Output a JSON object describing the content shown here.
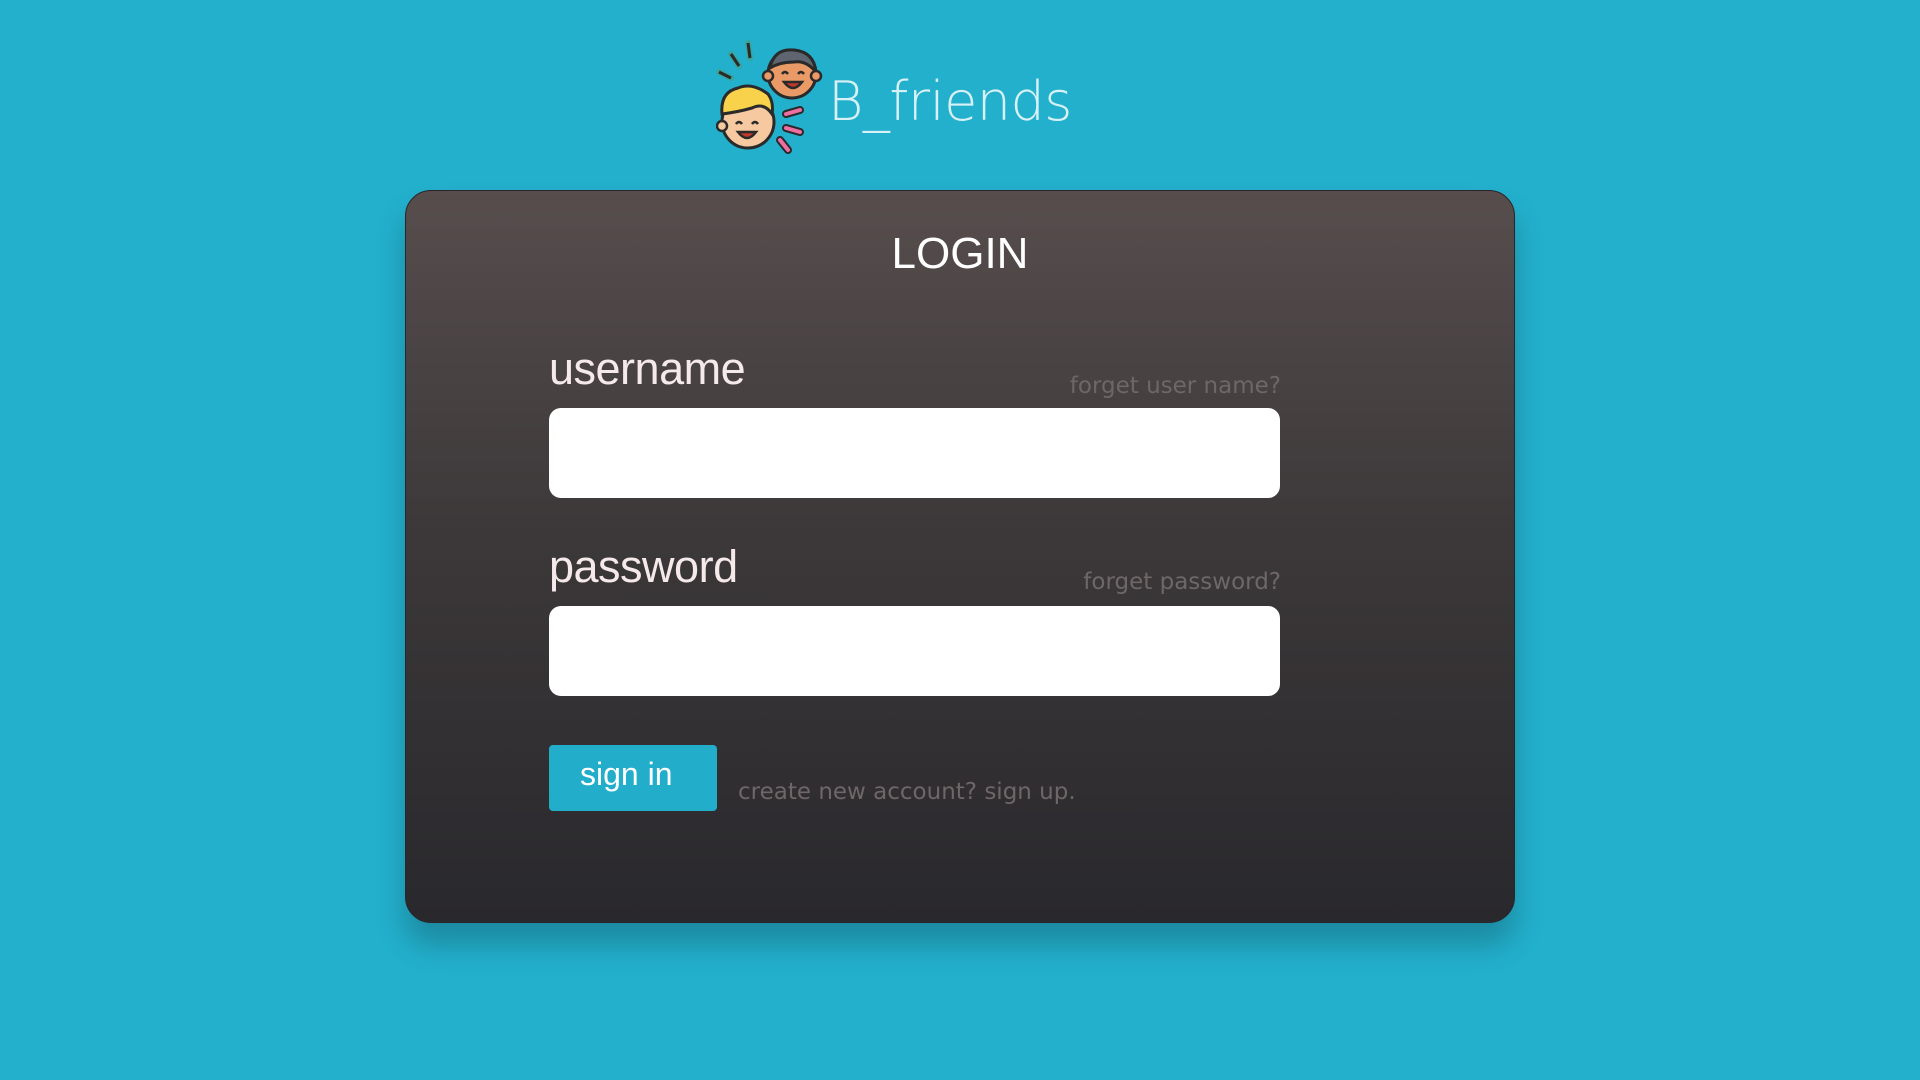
{
  "brand": {
    "name": "B_friends",
    "logo_icon": "two-happy-friends-icon"
  },
  "login": {
    "title": "LOGIN",
    "username": {
      "label": "username",
      "value": "",
      "placeholder": "",
      "help_link": "forget user name?"
    },
    "password": {
      "label": "password",
      "value": "",
      "placeholder": "",
      "help_link": "forget password?"
    },
    "submit_label": "sign in",
    "signup_link": "create new account? sign up."
  },
  "colors": {
    "background": "#23b0cd",
    "card_top": "#574d4d",
    "card_bottom": "#29282c",
    "accent_button": "#22adcb",
    "muted_link": "#6e6667",
    "brand_text": "#d8f1f6"
  }
}
